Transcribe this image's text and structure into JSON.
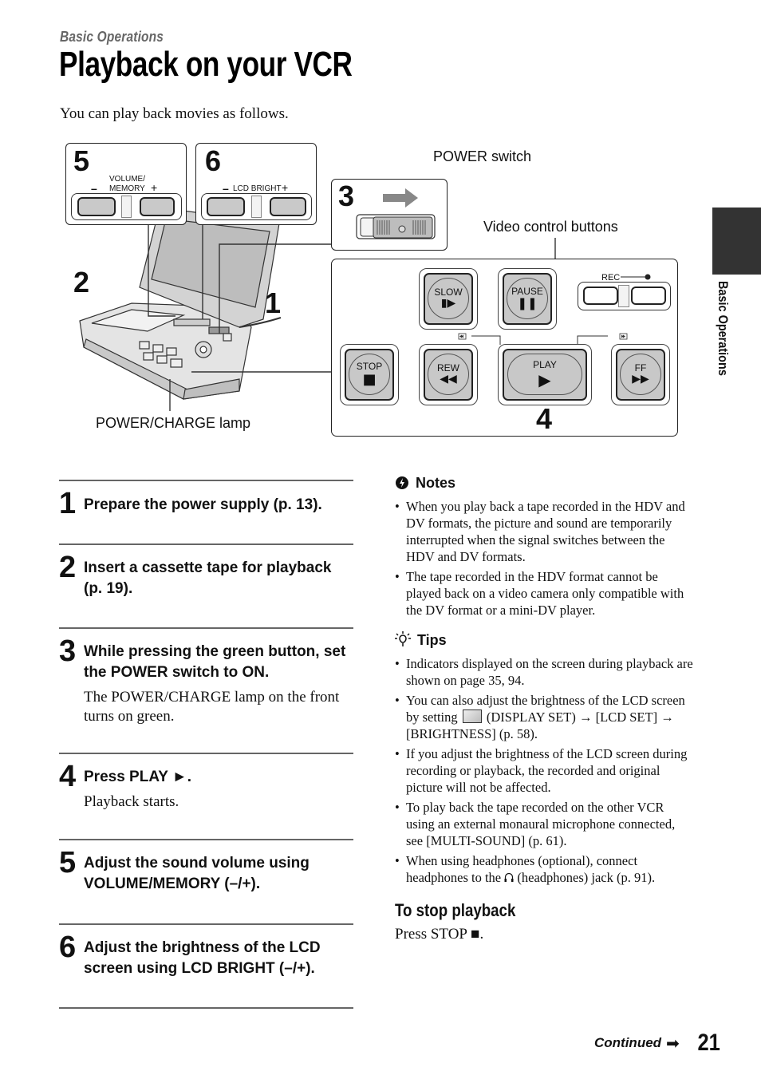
{
  "header": {
    "section": "Basic Operations",
    "title": "Playback on your VCR",
    "intro": "You can play back movies as follows."
  },
  "side_tab": {
    "label": "Basic Operations"
  },
  "diagram": {
    "callouts": {
      "power_switch": "POWER switch",
      "video_control_buttons": "Video control buttons",
      "power_charge_lamp": "POWER/CHARGE lamp"
    },
    "step_markers": [
      "1",
      "2",
      "3",
      "4",
      "5",
      "6"
    ],
    "volume_panel": {
      "label_line1": "VOLUME/",
      "label_line2": "MEMORY",
      "minus": "–",
      "plus": "+"
    },
    "lcd_panel": {
      "label": "LCD BRIGHT",
      "minus": "–",
      "plus": "+"
    },
    "rec_label": "REC",
    "buttons": {
      "slow": {
        "label": "SLOW",
        "glyph": "▮▶"
      },
      "pause": {
        "label": "PAUSE",
        "glyph": "❚❚"
      },
      "stop": {
        "label": "STOP",
        "glyph": "■"
      },
      "rew": {
        "label": "REW",
        "glyph": "◀◀"
      },
      "play": {
        "label": "PLAY",
        "glyph": "▶"
      },
      "ff": {
        "label": "FF",
        "glyph": "▶▶"
      }
    }
  },
  "steps": [
    {
      "number": "1",
      "title": "Prepare the power supply (p. 13).",
      "body": ""
    },
    {
      "number": "2",
      "title": "Insert a cassette tape for playback (p. 19).",
      "body": ""
    },
    {
      "number": "3",
      "title": "While pressing the green button, set the POWER switch to ON.",
      "body": "The POWER/CHARGE lamp on the front turns on green."
    },
    {
      "number": "4",
      "title": "Press PLAY ►.",
      "body": "Playback starts."
    },
    {
      "number": "5",
      "title": "Adjust the sound volume using VOLUME/MEMORY (–/+).",
      "body": ""
    },
    {
      "number": "6",
      "title": "Adjust the brightness of the LCD screen using LCD BRIGHT (–/+).",
      "body": ""
    }
  ],
  "notes": {
    "heading": "Notes",
    "items": [
      "When you play back a tape recorded in the HDV and DV formats, the picture and sound are temporarily interrupted when the signal switches between the HDV and DV formats.",
      "The tape recorded in the HDV format cannot be played back on a video camera only compatible with the DV format or a mini-DV player."
    ]
  },
  "tips": {
    "heading": "Tips",
    "items": [
      "Indicators displayed on the screen during playback are shown on page 35, 94.",
      {
        "before": "You can also adjust the brightness of the LCD screen by setting",
        "after": "(DISPLAY SET) → [LCD SET] → [BRIGHTNESS] (p. 58)."
      },
      "If you adjust the brightness of the LCD screen during recording or playback, the recorded and original picture will not be affected.",
      "To play back the tape recorded on the other VCR using an external monaural microphone connected, see [MULTI-SOUND] (p. 61).",
      {
        "before": "When using headphones (optional), connect headphones to the",
        "icon": "♫",
        "after": "(headphones) jack (p. 91)."
      }
    ]
  },
  "stop_section": {
    "heading": "To stop playback",
    "body": "Press STOP ■."
  },
  "footer": {
    "continued": "Continued",
    "arrow": "➡",
    "page_number": "21"
  }
}
